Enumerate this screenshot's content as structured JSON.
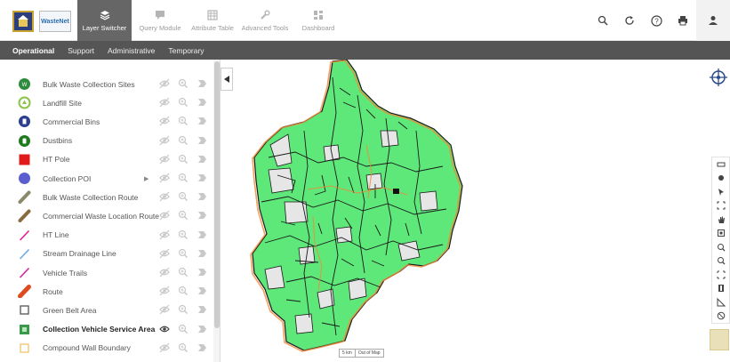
{
  "nav": {
    "tabs": [
      {
        "label": "Layer Switcher",
        "icon": "layers-icon",
        "active": true
      },
      {
        "label": "Query Module",
        "icon": "chat-icon"
      },
      {
        "label": "Attribute Table",
        "icon": "table-icon"
      },
      {
        "label": "Advanced Tools",
        "icon": "wrench-icon"
      },
      {
        "label": "Dashboard",
        "icon": "dashboard-icon"
      }
    ],
    "logo_text": "WasteNet"
  },
  "toolbar_icons": [
    "search-icon",
    "refresh-icon",
    "help-icon",
    "print-icon",
    "user-icon"
  ],
  "subtabs": [
    "Operational",
    "Support",
    "Administrative",
    "Temporary"
  ],
  "layers": [
    {
      "name": "Bulk Waste Collection Sites",
      "symbol": "bulk-site-icon",
      "color": "#2e8b3d"
    },
    {
      "name": "Landfill Site",
      "symbol": "landfill-icon",
      "color": "#8bc34a"
    },
    {
      "name": "Commercial Bins",
      "symbol": "commercial-bin-icon",
      "color": "#2c3e8f"
    },
    {
      "name": "Dustbins",
      "symbol": "dustbin-icon",
      "color": "#1f7a1f"
    },
    {
      "name": "HT Pole",
      "symbol": "square-icon",
      "color": "#e11b1b"
    },
    {
      "name": "Collection POI",
      "symbol": "circle-icon",
      "color": "#5a5ecf",
      "has_arrow": true
    },
    {
      "name": "Bulk Waste Collection Route",
      "symbol": "stroke-icon",
      "color": "#8a8a6a"
    },
    {
      "name": "Commercial Waste Location Route",
      "symbol": "stroke-icon",
      "color": "#8a6a3f"
    },
    {
      "name": "HT Line",
      "symbol": "line-icon",
      "color": "#e0208f"
    },
    {
      "name": "Stream Drainage Line",
      "symbol": "line-icon",
      "color": "#6aa9e8"
    },
    {
      "name": "Vehicle Trails",
      "symbol": "line-icon",
      "color": "#d0209a"
    },
    {
      "name": "Route",
      "symbol": "thick-stroke-icon",
      "color": "#e04a1f"
    },
    {
      "name": "Green Belt Area",
      "symbol": "square-outline-icon",
      "color": "#555555"
    },
    {
      "name": "Collection Vehicle Service Area",
      "symbol": "square-filled-icon",
      "color": "#3a9a4a",
      "visible": true
    },
    {
      "name": "Compound Wall Boundary",
      "symbol": "square-outline-icon",
      "color": "#f2c26b"
    }
  ],
  "map": {
    "scale_label": "5 km",
    "out_of_map_label": "Out of Map",
    "fill_color": "#5ee87a",
    "boundary_color": "#f08a3a"
  },
  "right_tools": [
    "ruler-icon",
    "dot-icon",
    "pointer-icon",
    "extent-icon",
    "pan-hand-icon",
    "select-box-icon",
    "zoom-in-icon",
    "zoom-out-icon",
    "fullscreen-icon",
    "book-icon",
    "measure-icon",
    "clear-icon"
  ]
}
